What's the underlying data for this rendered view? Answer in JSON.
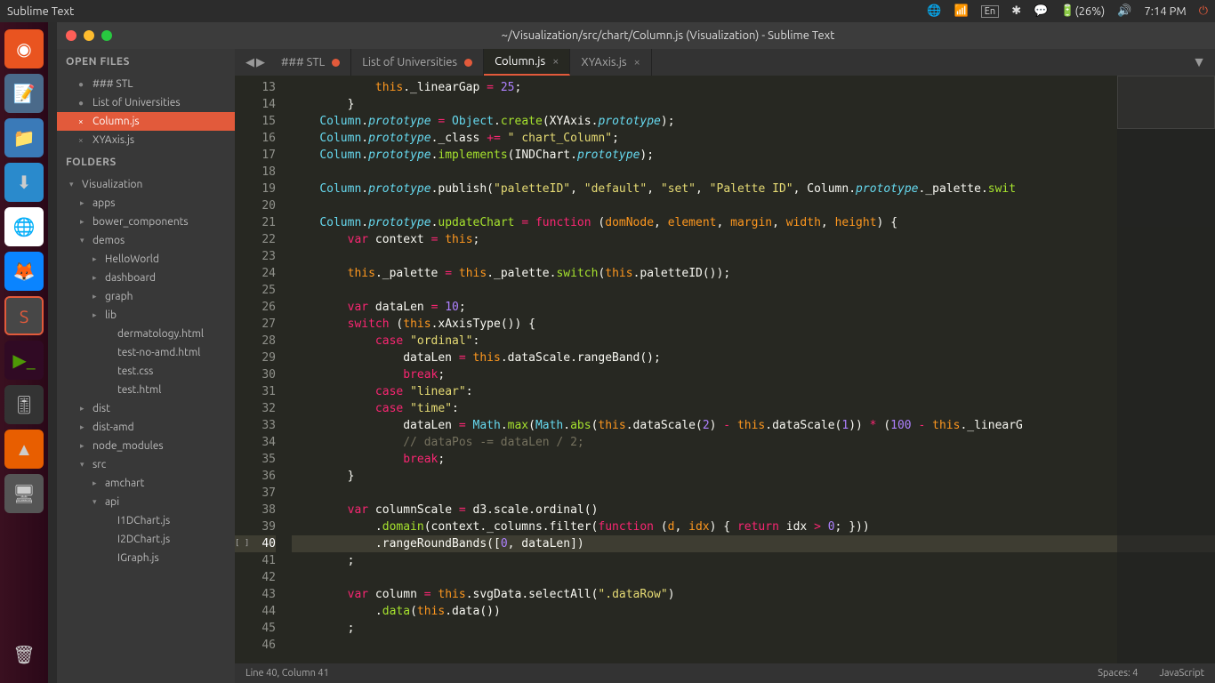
{
  "desktop": {
    "app_name": "Sublime Text",
    "battery": "(26%)",
    "time": "7:14 PM",
    "lang": "En"
  },
  "launcher": {
    "items": [
      "ubuntu",
      "notepad",
      "files",
      "downloads",
      "chrome",
      "firefox",
      "sublime",
      "terminal",
      "settings",
      "vlc",
      "display",
      "trash"
    ]
  },
  "window": {
    "title": "~/Visualization/src/chart/Column.js (Visualization) - Sublime Text"
  },
  "sidebar": {
    "open_files_header": "OPEN FILES",
    "open_files": [
      {
        "name": "### STL",
        "dirty": true,
        "active": false
      },
      {
        "name": "List of Universities",
        "dirty": true,
        "active": false
      },
      {
        "name": "Column.js",
        "dirty": false,
        "active": true
      },
      {
        "name": "XYAxis.js",
        "dirty": false,
        "active": false
      }
    ],
    "folders_header": "FOLDERS",
    "tree": [
      {
        "label": "Visualization",
        "level": 0,
        "open": true,
        "folder": true
      },
      {
        "label": "apps",
        "level": 1,
        "open": false,
        "folder": true
      },
      {
        "label": "bower_components",
        "level": 1,
        "open": false,
        "folder": true
      },
      {
        "label": "demos",
        "level": 1,
        "open": true,
        "folder": true
      },
      {
        "label": "HelloWorld",
        "level": 2,
        "open": false,
        "folder": true
      },
      {
        "label": "dashboard",
        "level": 2,
        "open": false,
        "folder": true
      },
      {
        "label": "graph",
        "level": 2,
        "open": false,
        "folder": true
      },
      {
        "label": "lib",
        "level": 2,
        "open": false,
        "folder": true
      },
      {
        "label": "dermatology.html",
        "level": 3,
        "folder": false
      },
      {
        "label": "test-no-amd.html",
        "level": 3,
        "folder": false
      },
      {
        "label": "test.css",
        "level": 3,
        "folder": false
      },
      {
        "label": "test.html",
        "level": 3,
        "folder": false
      },
      {
        "label": "dist",
        "level": 1,
        "open": false,
        "folder": true
      },
      {
        "label": "dist-amd",
        "level": 1,
        "open": false,
        "folder": true
      },
      {
        "label": "node_modules",
        "level": 1,
        "open": false,
        "folder": true
      },
      {
        "label": "src",
        "level": 1,
        "open": true,
        "folder": true
      },
      {
        "label": "amchart",
        "level": 2,
        "open": false,
        "folder": true
      },
      {
        "label": "api",
        "level": 2,
        "open": true,
        "folder": true
      },
      {
        "label": "I1DChart.js",
        "level": 3,
        "folder": false
      },
      {
        "label": "I2DChart.js",
        "level": 3,
        "folder": false
      },
      {
        "label": "IGraph.js",
        "level": 3,
        "folder": false
      }
    ]
  },
  "tabs": [
    {
      "label": "### STL",
      "dirty": true,
      "active": false
    },
    {
      "label": "List of Universities",
      "dirty": true,
      "active": false
    },
    {
      "label": "Column.js",
      "dirty": false,
      "active": true
    },
    {
      "label": "XYAxis.js",
      "dirty": false,
      "active": false
    }
  ],
  "code": {
    "first_line": 13,
    "lines": [
      "            <span class='th'>this</span>._linearGap <span class='op'>=</span> <span class='num'>25</span>;",
      "        }",
      "    <span class='cls'>Column</span>.<span class='fn'>prototype</span> <span class='op'>=</span> <span class='cls'>Object</span>.<span class='id'>create</span>(XYAxis.<span class='fn'>prototype</span>);",
      "    <span class='cls'>Column</span>.<span class='fn'>prototype</span>._class <span class='op'>+=</span> <span class='str'>\" chart_Column\"</span>;",
      "    <span class='cls'>Column</span>.<span class='fn'>prototype</span>.<span class='id'>implements</span>(INDChart.<span class='fn'>prototype</span>);",
      "",
      "    <span class='cls'>Column</span>.<span class='fn'>prototype</span>.publish(<span class='str'>\"paletteID\"</span>, <span class='str'>\"default\"</span>, <span class='str'>\"set\"</span>, <span class='str'>\"Palette ID\"</span>, Column.<span class='fn'>prototype</span>._palette.<span class='id'>swit</span>",
      "",
      "    <span class='cls'>Column</span>.<span class='fn'>prototype</span>.<span class='id'>updateChart</span> <span class='op'>=</span> <span class='kw'>function</span> (<span class='pr'>domNode</span>, <span class='pr'>element</span>, <span class='pr'>margin</span>, <span class='pr'>width</span>, <span class='pr'>height</span>) {",
      "        <span class='kw'>var</span> context <span class='op'>=</span> <span class='th'>this</span>;",
      "",
      "        <span class='th'>this</span>._palette <span class='op'>=</span> <span class='th'>this</span>._palette.<span class='id'>switch</span>(<span class='th'>this</span>.paletteID());",
      "",
      "        <span class='kw'>var</span> dataLen <span class='op'>=</span> <span class='num'>10</span>;",
      "        <span class='kw'>switch</span> (<span class='th'>this</span>.xAxisType()) {",
      "            <span class='kw'>case</span> <span class='str'>\"ordinal\"</span>:",
      "                dataLen <span class='op'>=</span> <span class='th'>this</span>.dataScale.rangeBand();",
      "                <span class='kw'>break</span>;",
      "            <span class='kw'>case</span> <span class='str'>\"linear\"</span>:",
      "            <span class='kw'>case</span> <span class='str'>\"time\"</span>:",
      "                dataLen <span class='op'>=</span> <span class='cls'>Math</span>.<span class='id'>max</span>(<span class='cls'>Math</span>.<span class='id'>abs</span>(<span class='th'>this</span>.dataScale(<span class='num'>2</span>) <span class='op'>-</span> <span class='th'>this</span>.dataScale(<span class='num'>1</span>)) <span class='op'>*</span> (<span class='num'>100</span> <span class='op'>-</span> <span class='th'>this</span>._linearG",
      "                <span class='cm'>// dataPos -= dataLen / 2;</span>",
      "                <span class='kw'>break</span>;",
      "        }",
      "",
      "        <span class='kw'>var</span> columnScale <span class='op'>=</span> d3.scale.ordinal()",
      "            .<span class='id'>domain</span>(context._columns.filter(<span class='kw'>function</span> (<span class='pr'>d</span>, <span class='pr'>idx</span>) { <span class='kw'>return</span> idx <span class='op'>&gt;</span> <span class='num'>0</span>; }))",
      "            .rangeRoundBands([<span class='num'>0</span>, dataLen])",
      "        ;",
      "",
      "        <span class='kw'>var</span> column <span class='op'>=</span> <span class='th'>this</span>.svgData.selectAll(<span class='str'>\".dataRow\"</span>)",
      "            .<span class='id'>data</span>(<span class='th'>this</span>.data())",
      "        ;",
      ""
    ],
    "cursor_line": 40
  },
  "status": {
    "left": "Line 40, Column 41",
    "spaces": "Spaces: 4",
    "lang": "JavaScript"
  }
}
